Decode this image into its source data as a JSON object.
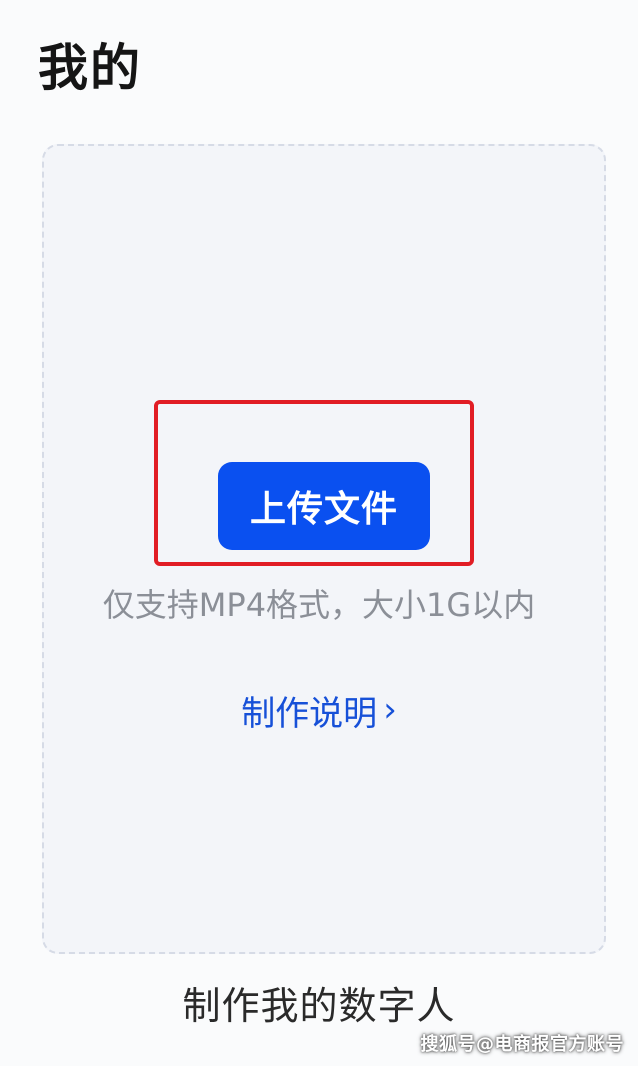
{
  "header": {
    "title": "我的"
  },
  "upload_card": {
    "upload_button_label": "上传文件",
    "hint": "仅支持MP4格式，大小1G以内",
    "instructions_label": "制作说明",
    "chevron_icon": "chevron-right-icon",
    "caption": "制作我的数字人"
  },
  "watermark": {
    "text": "搜狐号@电商报官方账号"
  },
  "colors": {
    "primary_button": "#0a50f0",
    "link": "#1650d8",
    "highlight_border": "#e11d25",
    "card_background": "#f3f5f9",
    "card_border": "#d6dbe6",
    "hint_text": "#8b8f97"
  }
}
